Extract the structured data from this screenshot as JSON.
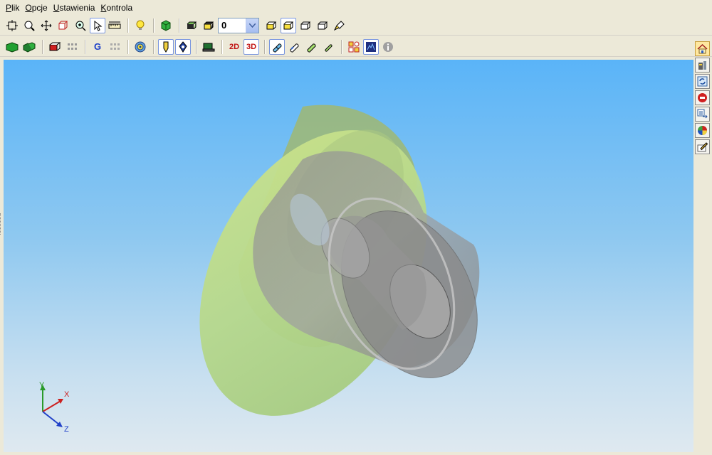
{
  "menu": {
    "items": [
      {
        "key": "P",
        "rest": "lik"
      },
      {
        "key": "O",
        "rest": "pcje"
      },
      {
        "key": "U",
        "rest": "stawienia"
      },
      {
        "key": "K",
        "rest": "ontrola"
      }
    ]
  },
  "toolbar1": {
    "layer_value": "0"
  },
  "toolbar2": {
    "g_label": "G",
    "view2d_label": "2D",
    "view3d_label": "3D"
  },
  "axes": {
    "x_label": "X",
    "y_label": "Y",
    "z_label": "Z"
  },
  "colors": {
    "flange": "#b8d88a",
    "body": "#8c8c8c",
    "x_axis": "#cc2020",
    "y_axis": "#2a9a2a",
    "z_axis": "#2040c8"
  }
}
